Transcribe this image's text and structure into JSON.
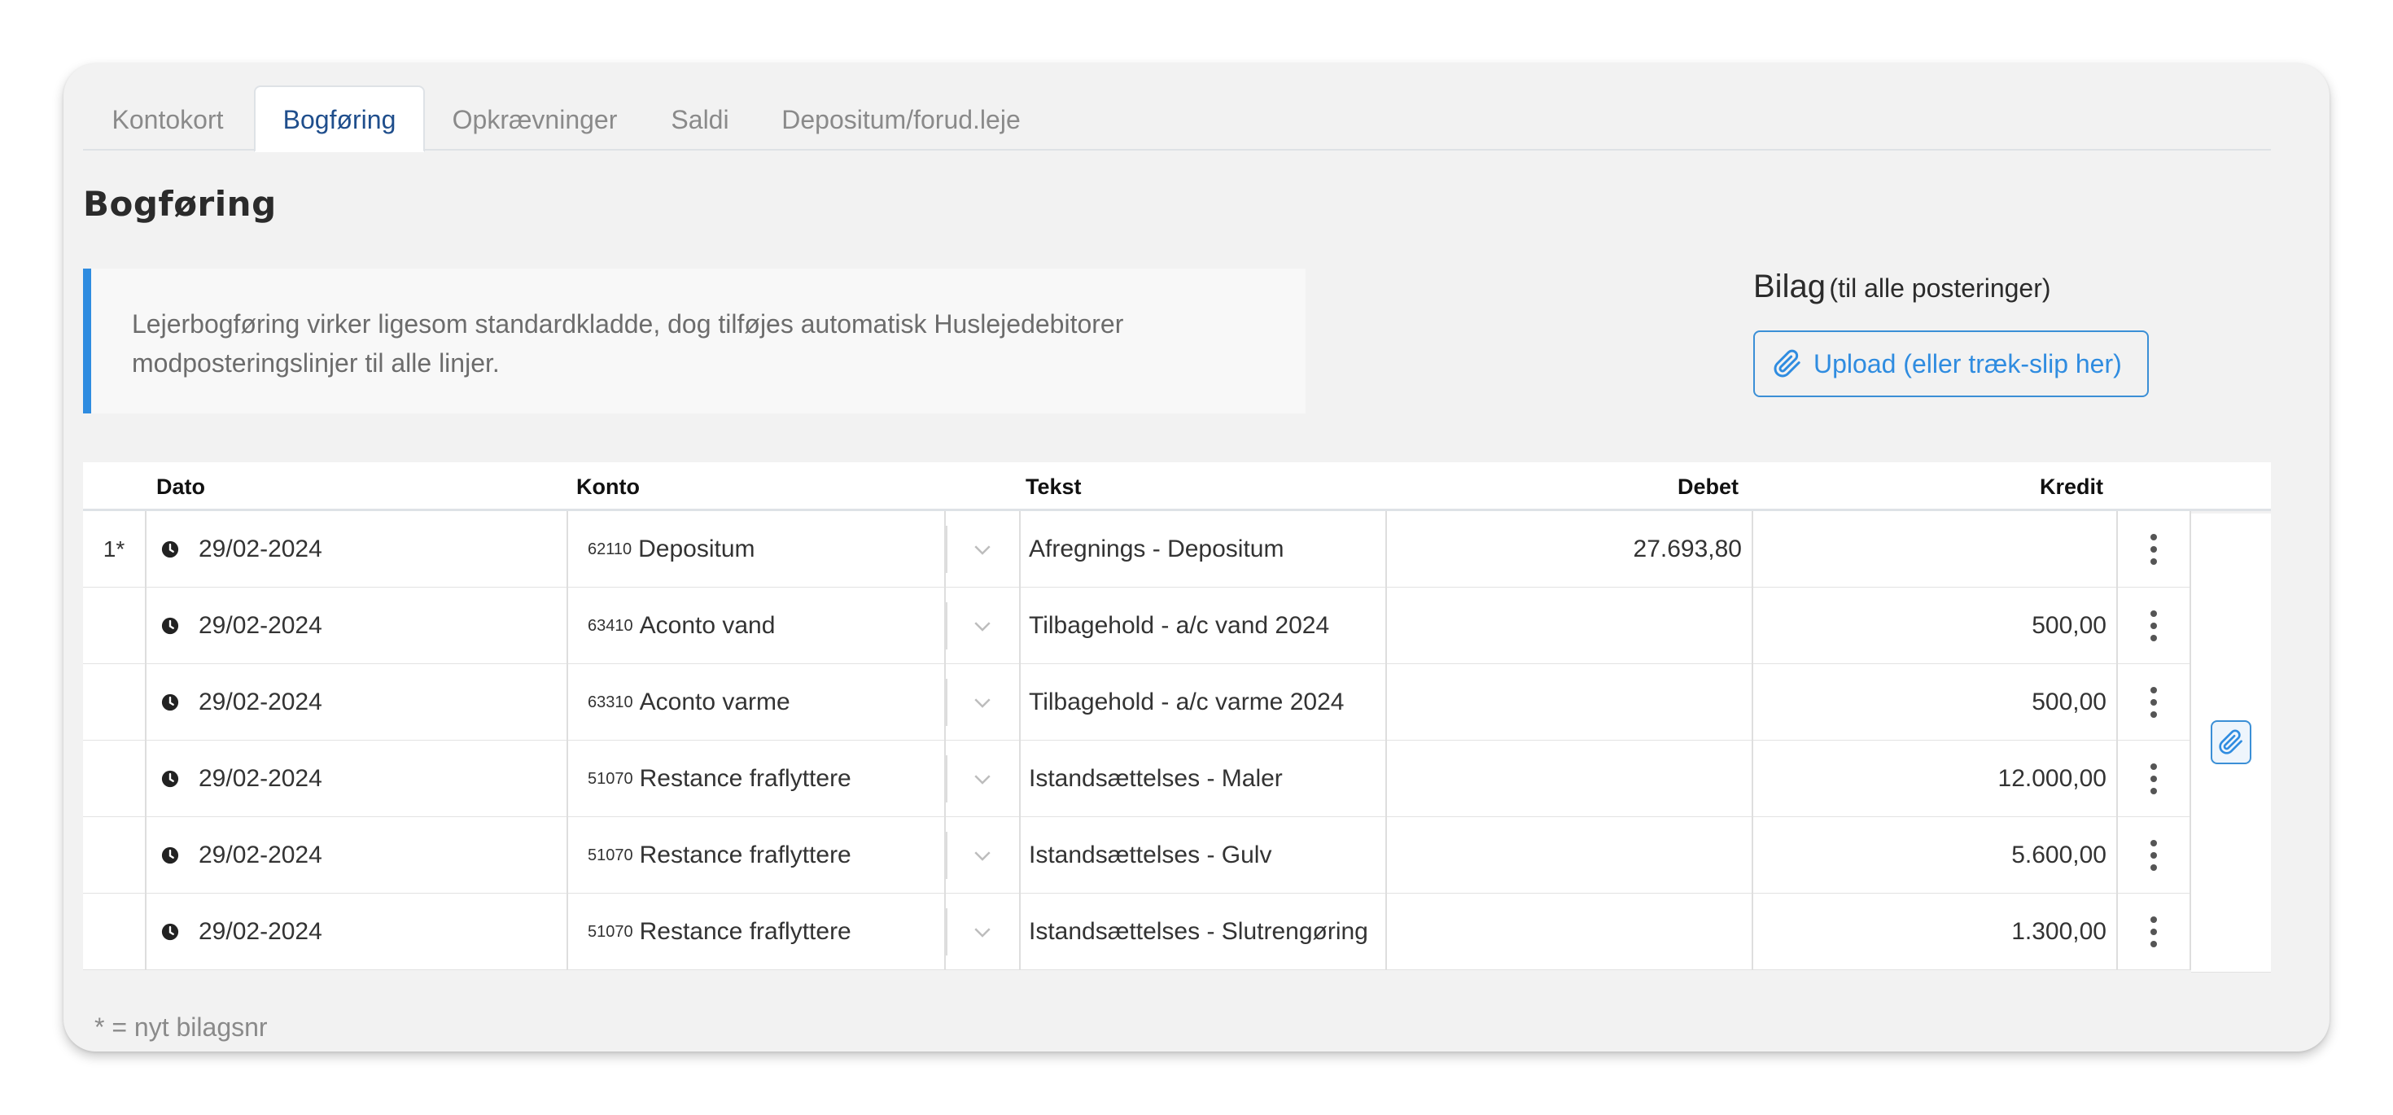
{
  "tabs": [
    {
      "label": "Kontokort",
      "active": false
    },
    {
      "label": "Bogføring",
      "active": true
    },
    {
      "label": "Opkrævninger",
      "active": false
    },
    {
      "label": "Saldi",
      "active": false
    },
    {
      "label": "Depositum/forud.leje",
      "active": false
    }
  ],
  "page_title": "Bogføring",
  "info": {
    "line1": "Lejerbogføring virker ligesom standardkladde, dog tilføjes automatisk Huslejedebitorer",
    "line2": "modposteringslinjer til alle linjer."
  },
  "bilag": {
    "title": "Bilag",
    "subtitle": "(til alle posteringer)",
    "upload_label": "Upload (eller træk-slip her)",
    "upload_icon": "paperclip-icon"
  },
  "table": {
    "headers": {
      "dato": "Dato",
      "konto": "Konto",
      "tekst": "Tekst",
      "debet": "Debet",
      "kredit": "Kredit"
    },
    "rows": [
      {
        "num": "1*",
        "date": "29/02-2024",
        "konto_nr": "62110",
        "konto_name": "Depositum",
        "tekst": "Afregnings - Depositum",
        "debet": "27.693,80",
        "kredit": ""
      },
      {
        "num": "",
        "date": "29/02-2024",
        "konto_nr": "63410",
        "konto_name": "Aconto vand",
        "tekst": "Tilbagehold - a/c vand 2024",
        "debet": "",
        "kredit": "500,00"
      },
      {
        "num": "",
        "date": "29/02-2024",
        "konto_nr": "63310",
        "konto_name": "Aconto varme",
        "tekst": "Tilbagehold - a/c varme 2024",
        "debet": "",
        "kredit": "500,00"
      },
      {
        "num": "",
        "date": "29/02-2024",
        "konto_nr": "51070",
        "konto_name": "Restance fraflyttere",
        "tekst": "Istandsættelses - Maler",
        "debet": "",
        "kredit": "12.000,00"
      },
      {
        "num": "",
        "date": "29/02-2024",
        "konto_nr": "51070",
        "konto_name": "Restance fraflyttere",
        "tekst": "Istandsættelses - Gulv",
        "debet": "",
        "kredit": "5.600,00"
      },
      {
        "num": "",
        "date": "29/02-2024",
        "konto_nr": "51070",
        "konto_name": "Restance fraflyttere",
        "tekst": "Istandsættelses - Slutrengøring",
        "debet": "",
        "kredit": "1.300,00"
      }
    ]
  },
  "footnote": "* = nyt bilagsnr",
  "colors": {
    "accent": "#2f8ce0",
    "active_tab_text": "#1f4e8c",
    "card_background": "#f2f2f2"
  }
}
